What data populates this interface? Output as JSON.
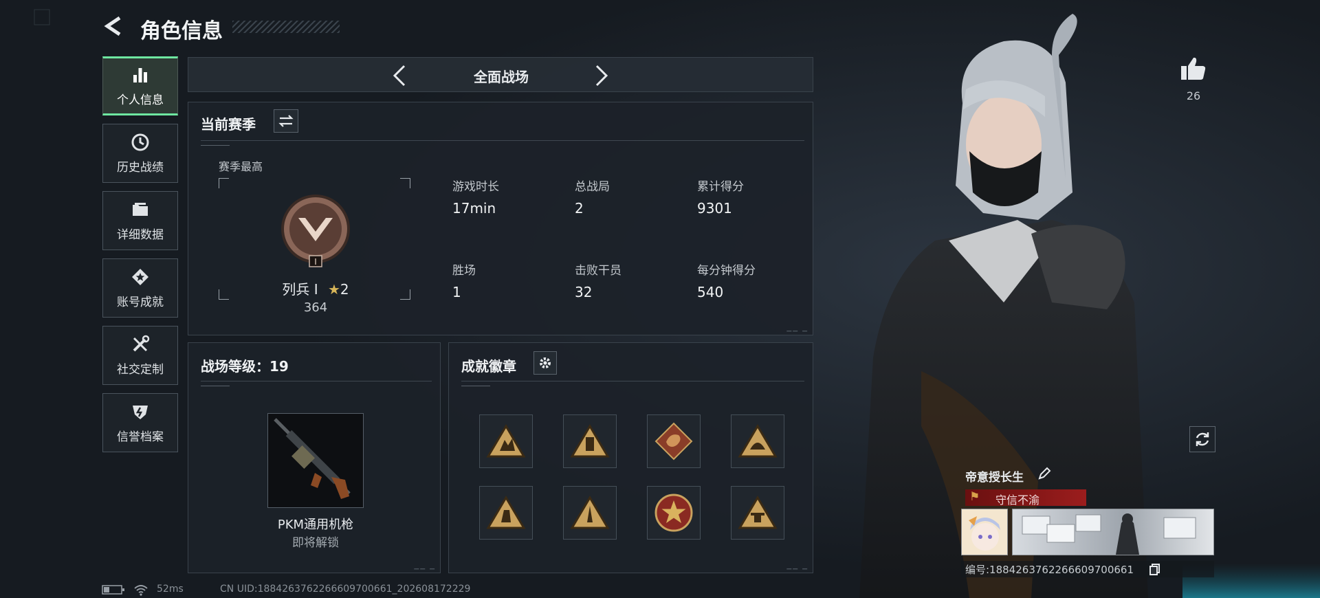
{
  "header": {
    "title": "角色信息"
  },
  "sidebar": {
    "items": [
      {
        "label": "个人信息",
        "icon": "bar-chart-icon",
        "active": true
      },
      {
        "label": "历史战绩",
        "icon": "clock-icon",
        "active": false
      },
      {
        "label": "详细数据",
        "icon": "folder-icon",
        "active": false
      },
      {
        "label": "账号成就",
        "icon": "star-medal-icon",
        "active": false
      },
      {
        "label": "社交定制",
        "icon": "tools-icon",
        "active": false
      },
      {
        "label": "信誉档案",
        "icon": "shield-icon",
        "active": false
      }
    ]
  },
  "mode": {
    "label": "全面战场"
  },
  "season": {
    "title": "当前赛季",
    "best_label": "赛季最高",
    "rank": "列兵 I",
    "stars": "2",
    "score": "364",
    "rank_badge_numeral": "I",
    "stats": [
      {
        "label": "游戏时长",
        "value": "17min"
      },
      {
        "label": "总战局",
        "value": "2"
      },
      {
        "label": "累计得分",
        "value": "9301"
      },
      {
        "label": "胜场",
        "value": "1"
      },
      {
        "label": "击败干员",
        "value": "32"
      },
      {
        "label": "每分钟得分",
        "value": "540"
      }
    ]
  },
  "battlefield_level": {
    "title": "战场等级：19",
    "weapon_name": "PKM通用机枪",
    "weapon_status": "即将解锁"
  },
  "achievements": {
    "title": "成就徽章",
    "badges": [
      "triangle-badge-icon",
      "triangle-badge-icon",
      "dragon-diamond-badge-icon",
      "triangle-badge-icon",
      "triangle-badge-icon",
      "triangle-badge-icon",
      "round-star-badge-icon",
      "triangle-badge-icon"
    ]
  },
  "likes": {
    "count": "26"
  },
  "player_card": {
    "name": "帝意授长生",
    "title_tag": "守信不渝",
    "id_label": "编号:1884263762266609700661"
  },
  "status_bar": {
    "ping": "52ms",
    "uid": "CN UID:1884263762266609700661_202608172229"
  },
  "colors": {
    "accent": "#6ee7a1",
    "badge_gold": "#c9a25e",
    "tag_red": "#9b1d1d"
  }
}
